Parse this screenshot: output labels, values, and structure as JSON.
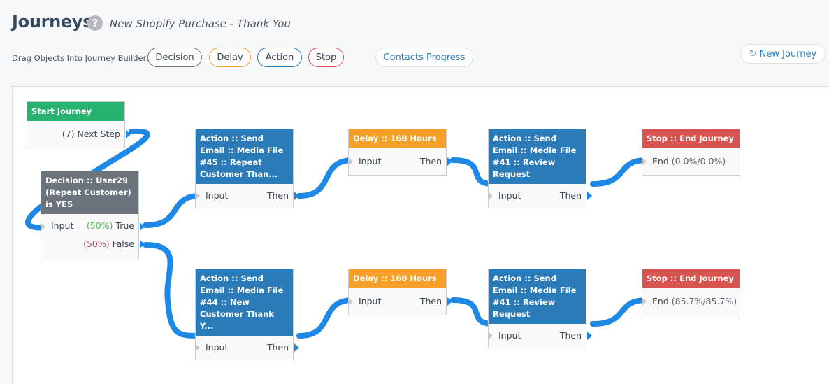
{
  "header": {
    "title": "Journeys",
    "help_icon": "question-circle",
    "subtitle": "New Shopify Purchase - Thank You"
  },
  "toolbar": {
    "drag_label": "Drag Objects Into Journey Builder:",
    "decision_label": "Decision",
    "delay_label": "Delay",
    "action_label": "Action",
    "stop_label": "Stop",
    "contacts_progress_label": "Contacts Progress",
    "new_journey_label": "New Journey",
    "new_journey_icon": "refresh-icon"
  },
  "colors": {
    "start": "#27b36f",
    "decision": "#6b737b",
    "action": "#2b7bb9",
    "delay": "#f6a02a",
    "stop": "#d9534f",
    "wire": "#1e88e5"
  },
  "nodes": {
    "start": {
      "title": "Start Journey",
      "output": "(7) Next Step"
    },
    "decision": {
      "title": "Decision :: User29 (Repeat Customer) is YES",
      "input": "Input",
      "true_pct": "(50%)",
      "true_label": "True",
      "false_pct": "(50%)",
      "false_label": "False"
    },
    "action_top": {
      "title": "Action :: Send Email :: Media File #45 :: Repeat Customer Than...",
      "input": "Input",
      "output": "Then"
    },
    "delay_top": {
      "title": "Delay :: 168 Hours",
      "input": "Input",
      "output": "Then"
    },
    "review_top": {
      "title": "Action :: Send Email :: Media File #41 :: Review Request",
      "input": "Input",
      "output": "Then"
    },
    "stop_top": {
      "title": "Stop :: End Journey",
      "end_label": "End",
      "end_stats": "(0.0%/0.0%)"
    },
    "action_bottom": {
      "title": "Action :: Send Email :: Media File #44 :: New Customer Thank Y...",
      "input": "Input",
      "output": "Then"
    },
    "delay_bottom": {
      "title": "Delay :: 168 Hours",
      "input": "Input",
      "output": "Then"
    },
    "review_bottom": {
      "title": "Action :: Send Email :: Media File #41 :: Review Request",
      "input": "Input",
      "output": "Then"
    },
    "stop_bottom": {
      "title": "Stop :: End Journey",
      "end_label": "End",
      "end_stats": "(85.7%/85.7%)"
    }
  }
}
